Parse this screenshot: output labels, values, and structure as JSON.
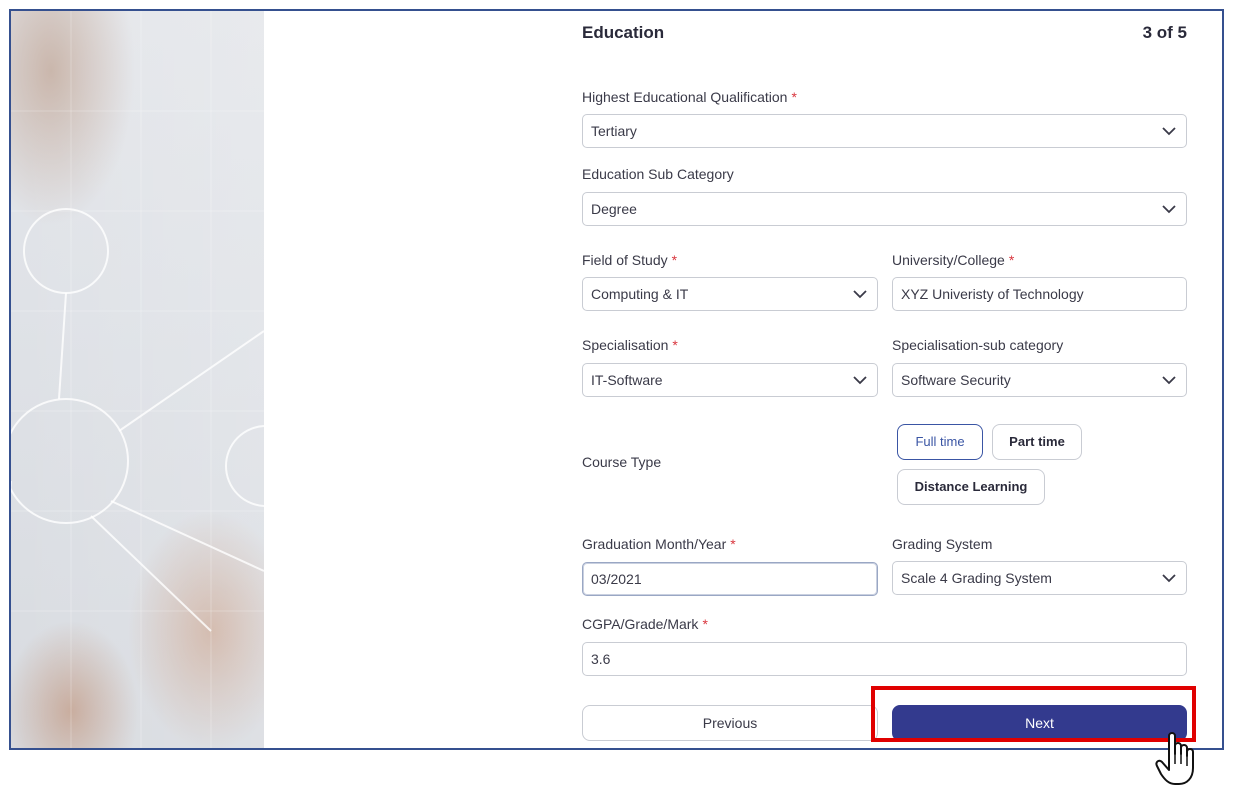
{
  "header": {
    "title": "Education",
    "step": "3 of 5"
  },
  "fields": {
    "qualification": {
      "label": "Highest Educational Qualification",
      "required": "*",
      "value": "Tertiary"
    },
    "sub_category": {
      "label": "Education Sub Category",
      "value": "Degree"
    },
    "field_of_study": {
      "label": "Field of Study",
      "required": "*",
      "value": "Computing & IT"
    },
    "university": {
      "label": "University/College",
      "required": "*",
      "value": "XYZ Univeristy of Technology"
    },
    "specialisation": {
      "label": "Specialisation",
      "required": "*",
      "value": "IT-Software"
    },
    "specialisation_sub": {
      "label": "Specialisation-sub category",
      "value": "Software Security"
    },
    "course_type": {
      "label": "Course Type",
      "options": [
        "Full time",
        "Part time",
        "Distance Learning"
      ],
      "selected": "Full time"
    },
    "graduation": {
      "label": "Graduation Month/Year",
      "required": "*",
      "value": "03/2021"
    },
    "grading": {
      "label": "Grading System",
      "value": "Scale 4 Grading System"
    },
    "cgpa": {
      "label": "CGPA/Grade/Mark",
      "required": "*",
      "value": "3.6"
    }
  },
  "buttons": {
    "previous": "Previous",
    "next": "Next"
  },
  "icons": {
    "dropdown": "chevron-down-icon",
    "cursor": "hand-pointer-icon",
    "decor": "network-nodes-graphic"
  },
  "colors": {
    "primary": "#333a8e",
    "required": "#d9363e",
    "highlight": "#e00000",
    "border": "#35508f"
  }
}
